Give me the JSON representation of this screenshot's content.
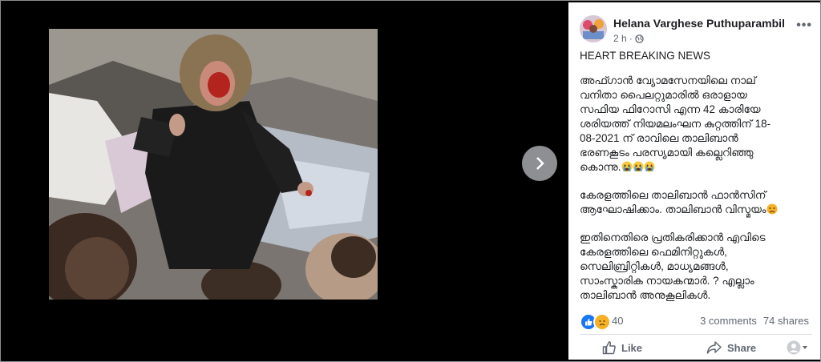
{
  "post": {
    "author": "Helana Varghese Puthuparambil",
    "time": "2 h",
    "separator": "·",
    "headline": "HEART BREAKING NEWS",
    "paragraph1": "അഫ്ഗാൻ വ്യോമസേനയിലെ നാല്\nവനിതാ പൈലറ്റുമാരിൽ ഒരാളായ\nസഫിയ ഫിറോസി എന്ന 42 കാരിയേ\nശരിയത്ത് നിയമലംഘന കുറ്റത്തിന് 18-\n08-2021 ന് രാവിലെ താലിബാൻ\nഭരണകൂടം പരസ്യമായി കല്ലെറിഞ്ഞു\nകൊന്നു.",
    "paragraph2": "കേരളത്തിലെ താലിബാൻ ഫാൻസിന്\nആഘോഷിക്കാം. താലിബാൻ വിസ്മയം",
    "paragraph3": "ഇതിനെതിരെ പ്രതികരിക്കാൻ എവിടെ\nകേരളത്തിലെ ഫെമിനിറ്റുകൾ,\nസെലിബ്രിറ്റികൾ, മാധ്യമങ്ങൾ,\nസാംസ്കാരിക നായകന്മാർ. ? എല്ലാം\nതാലിബാൻ അനുകൂലികൾ."
  },
  "stats": {
    "reactions": "40",
    "comments": "3 comments",
    "shares": "74 shares"
  },
  "actions": {
    "like": "Like",
    "share": "Share"
  },
  "colors": {
    "facebook_blue": "#1877f2",
    "sad_yellow": "#f7b125",
    "like_blue": "#1877f2"
  },
  "icons": [
    "globe-icon",
    "more-options-icon",
    "chevron-right-icon",
    "like-reaction-icon",
    "sad-reaction-icon",
    "thumbs-up-icon",
    "share-icon",
    "avatar-dropdown-icon",
    "crying-emoji",
    "sad-emoji"
  ]
}
